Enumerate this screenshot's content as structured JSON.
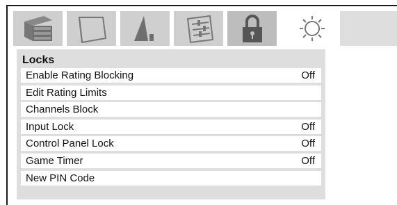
{
  "tabs": [
    {
      "icon": "picture-stack-icon"
    },
    {
      "icon": "screen-icon"
    },
    {
      "icon": "speaker-icon"
    },
    {
      "icon": "settings-sliders-icon"
    },
    {
      "icon": "lock-icon",
      "selected": true
    },
    {
      "icon": "sun-icon"
    }
  ],
  "panel": {
    "title": "Locks",
    "items": [
      {
        "label": "Enable Rating Blocking",
        "value": "Off"
      },
      {
        "label": "Edit Rating Limits",
        "value": ""
      },
      {
        "label": "Channels Block",
        "value": ""
      },
      {
        "label": "Input Lock",
        "value": "Off"
      },
      {
        "label": "Control Panel Lock",
        "value": "Off"
      },
      {
        "label": "Game Timer",
        "value": "Off"
      },
      {
        "label": "New PIN Code",
        "value": ""
      }
    ]
  }
}
